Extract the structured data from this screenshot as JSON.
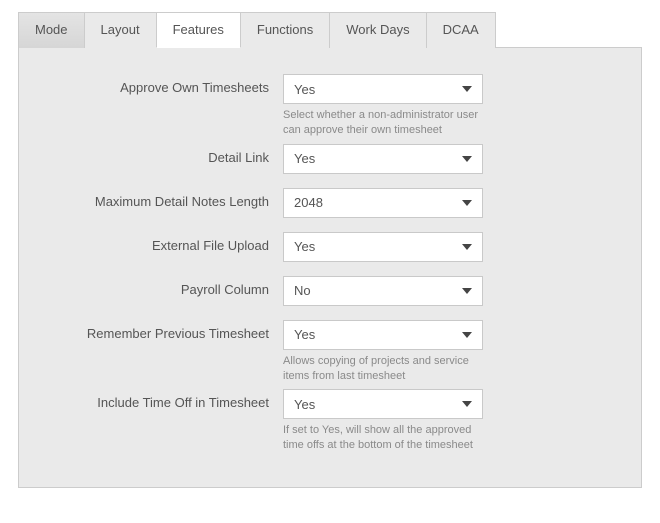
{
  "tabs": [
    {
      "label": "Mode"
    },
    {
      "label": "Layout"
    },
    {
      "label": "Features"
    },
    {
      "label": "Functions"
    },
    {
      "label": "Work Days"
    },
    {
      "label": "DCAA"
    }
  ],
  "active_tab_index": 2,
  "highlight_tab_index": 0,
  "fields": {
    "approve_own": {
      "label": "Approve Own Timesheets",
      "value": "Yes",
      "help": "Select whether a non-administrator user can approve their own timesheet"
    },
    "detail_link": {
      "label": "Detail Link",
      "value": "Yes"
    },
    "max_detail_notes": {
      "label": "Maximum Detail Notes Length",
      "value": "2048"
    },
    "external_upload": {
      "label": "External File Upload",
      "value": "Yes"
    },
    "payroll_column": {
      "label": "Payroll Column",
      "value": "No"
    },
    "remember_prev": {
      "label": "Remember Previous Timesheet",
      "value": "Yes",
      "help": "Allows copying of projects and service items from last timesheet"
    },
    "include_time_off": {
      "label": "Include Time Off in Timesheet",
      "value": "Yes",
      "help": "If set to Yes, will show all the approved time offs at the bottom of the timesheet"
    }
  }
}
